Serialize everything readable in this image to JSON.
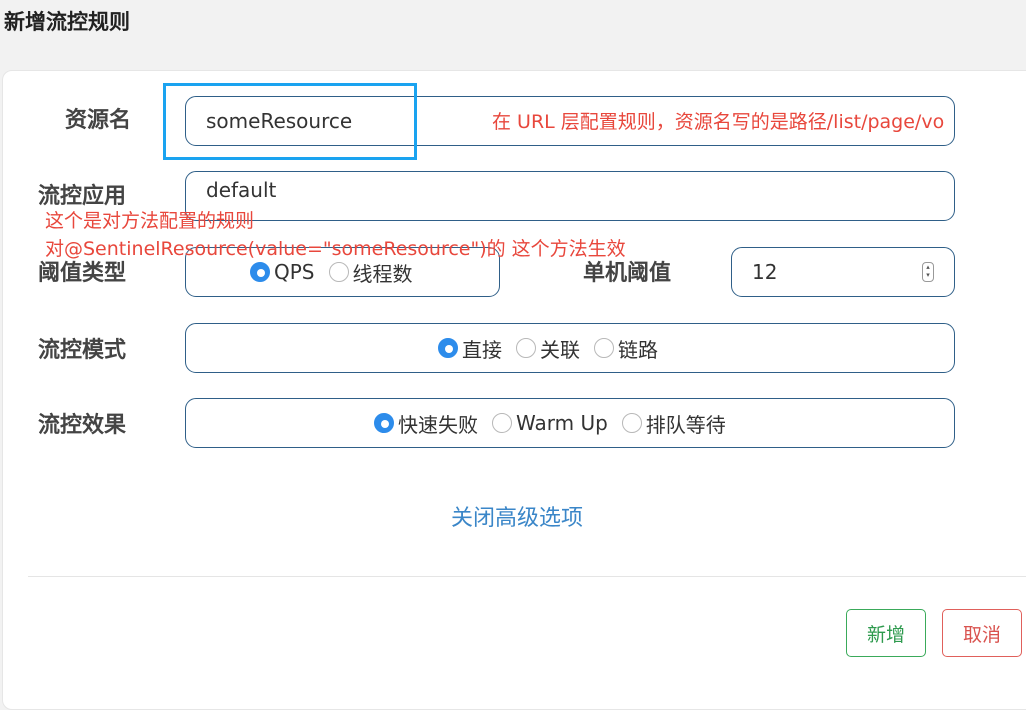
{
  "dialog": {
    "title": "新增流控规则"
  },
  "form": {
    "resource": {
      "label": "资源名",
      "value": "someResource"
    },
    "app": {
      "label": "流控应用",
      "value": "default"
    },
    "threshold_type": {
      "label": "阈值类型",
      "options": [
        "QPS",
        "线程数"
      ],
      "selected": "QPS"
    },
    "single_threshold": {
      "label": "单机阈值",
      "value": "12"
    },
    "mode": {
      "label": "流控模式",
      "options": [
        "直接",
        "关联",
        "链路"
      ],
      "selected": "直接"
    },
    "effect": {
      "label": "流控效果",
      "options": [
        "快速失败",
        "Warm Up",
        "排队等待"
      ],
      "selected": "快速失败"
    }
  },
  "advanced_link": "关闭高级选项",
  "buttons": {
    "add": "新增",
    "cancel": "取消"
  },
  "annotations": {
    "url_note": "在 URL 层配置规则，资源名写的是路径/list/page/vo",
    "method_note_1": "这个是对方法配置的规则",
    "method_note_2": "对@SentinelResource(value=\"someResource\")的 这个方法生效"
  },
  "colors": {
    "primary": "#2d8ceb",
    "link": "#3a86c8",
    "success": "#3aaa5a",
    "danger": "#d9534f",
    "annotation_text": "#e8473c",
    "annotation_box": "#1aa3f0"
  }
}
